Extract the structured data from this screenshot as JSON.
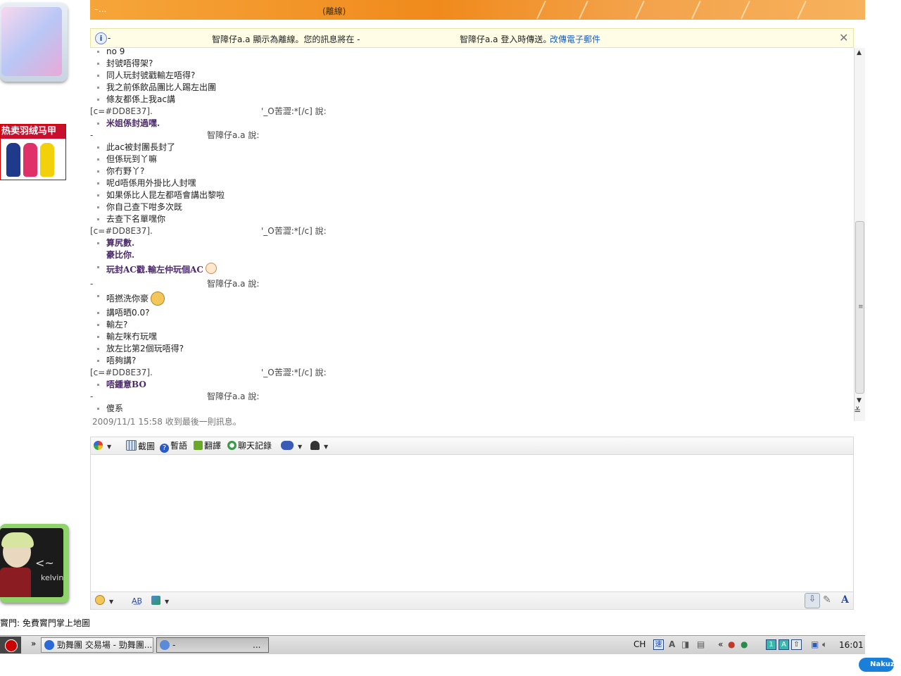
{
  "window": {
    "title_left": "–...",
    "title_status": "(離線)"
  },
  "notice": {
    "prefix": "-",
    "text1": "智障仔a.a 顯示為離線。您的訊息將在 -",
    "text2": "智障仔a.a 登入時傳送。",
    "link": "改傳電子郵件",
    "close": "✕"
  },
  "chat": {
    "lines": [
      {
        "type": "msg",
        "text": "no 9"
      },
      {
        "type": "msg",
        "text": "封號唔得架?"
      },
      {
        "type": "msg",
        "text": "同人玩封號戳輸左唔得?"
      },
      {
        "type": "msg",
        "text": "我之前係飲品團比人踢左出團"
      },
      {
        "type": "msg",
        "text": "條友都係上我ac講"
      },
      {
        "type": "header",
        "left": "[c=#DD8E37].",
        "sayer": "'_O苦澀:*[/c] 說:"
      },
      {
        "type": "bold",
        "text": "米姐係封過嘿."
      },
      {
        "type": "header2",
        "left": "-",
        "sayer": "智障仔a.a 說:"
      },
      {
        "type": "msg",
        "text": "此ac被封團長封了"
      },
      {
        "type": "msg",
        "text": "但係玩到丫嘛"
      },
      {
        "type": "msg",
        "text": "你冇野丫?"
      },
      {
        "type": "msg",
        "text": "呢d唔係用外掛比人封嘿"
      },
      {
        "type": "msg",
        "text": "如果係比人昆左都唔會講出黎啦"
      },
      {
        "type": "msg",
        "text": "你自己查下咁多次既"
      },
      {
        "type": "msg",
        "text": "去查下名單嘿你"
      },
      {
        "type": "header",
        "left": "[c=#DD8E37].",
        "sayer": "'_O苦澀:*[/c] 說:"
      },
      {
        "type": "bold",
        "text": "算尻數."
      },
      {
        "type": "boldplain",
        "text": "豪比你."
      },
      {
        "type": "boldemoji",
        "text": "玩封AC戳.輸左仲玩個AC"
      },
      {
        "type": "header2",
        "left": "-",
        "sayer": "智障仔a.a 說:"
      },
      {
        "type": "msgemoji",
        "text": "唔撚洗你豪"
      },
      {
        "type": "msg",
        "text": "講唔晒0.0?"
      },
      {
        "type": "msg",
        "text": "輸左?"
      },
      {
        "type": "msg",
        "text": "輸左咪冇玩嘿"
      },
      {
        "type": "msg",
        "text": "放左比第2個玩唔得?"
      },
      {
        "type": "msg",
        "text": "唔夠講?"
      },
      {
        "type": "header",
        "left": "[c=#DD8E37].",
        "sayer": "'_O苦澀:*[/c] 說:"
      },
      {
        "type": "bold",
        "text": "唔鍾意BO"
      },
      {
        "type": "header2",
        "left": "-",
        "sayer": "智障仔a.a 說:"
      },
      {
        "type": "msg",
        "text": "傻系"
      }
    ],
    "timestamp": "2009/11/1 15:58 收到最後一則訊息。"
  },
  "toolbar": {
    "screenshot": "截圖",
    "hint": "暫語",
    "translate": "翻譯",
    "history": "聊天記錄"
  },
  "left": {
    "ad_title": "热卖羽绒马甲",
    "avatar_name": "kelvin",
    "avatar_arrow": "<~",
    "status": "竇門: 免費竇門掌上地圖"
  },
  "taskbar": {
    "chevron": "»",
    "task1": "勁舞團 交易場 - 勁舞團...",
    "task2": "-",
    "task2_end": "...",
    "tray_lang": "CH",
    "tray_more": "«",
    "clock": "16:01"
  },
  "brand": "Nakuz",
  "colors": {
    "title_orange": "#f08a1c",
    "notice_bg": "#fffde6",
    "link_blue": "#1a5fc0",
    "bold_purple": "#4b2a6a",
    "ad_red": "#c8102e"
  }
}
